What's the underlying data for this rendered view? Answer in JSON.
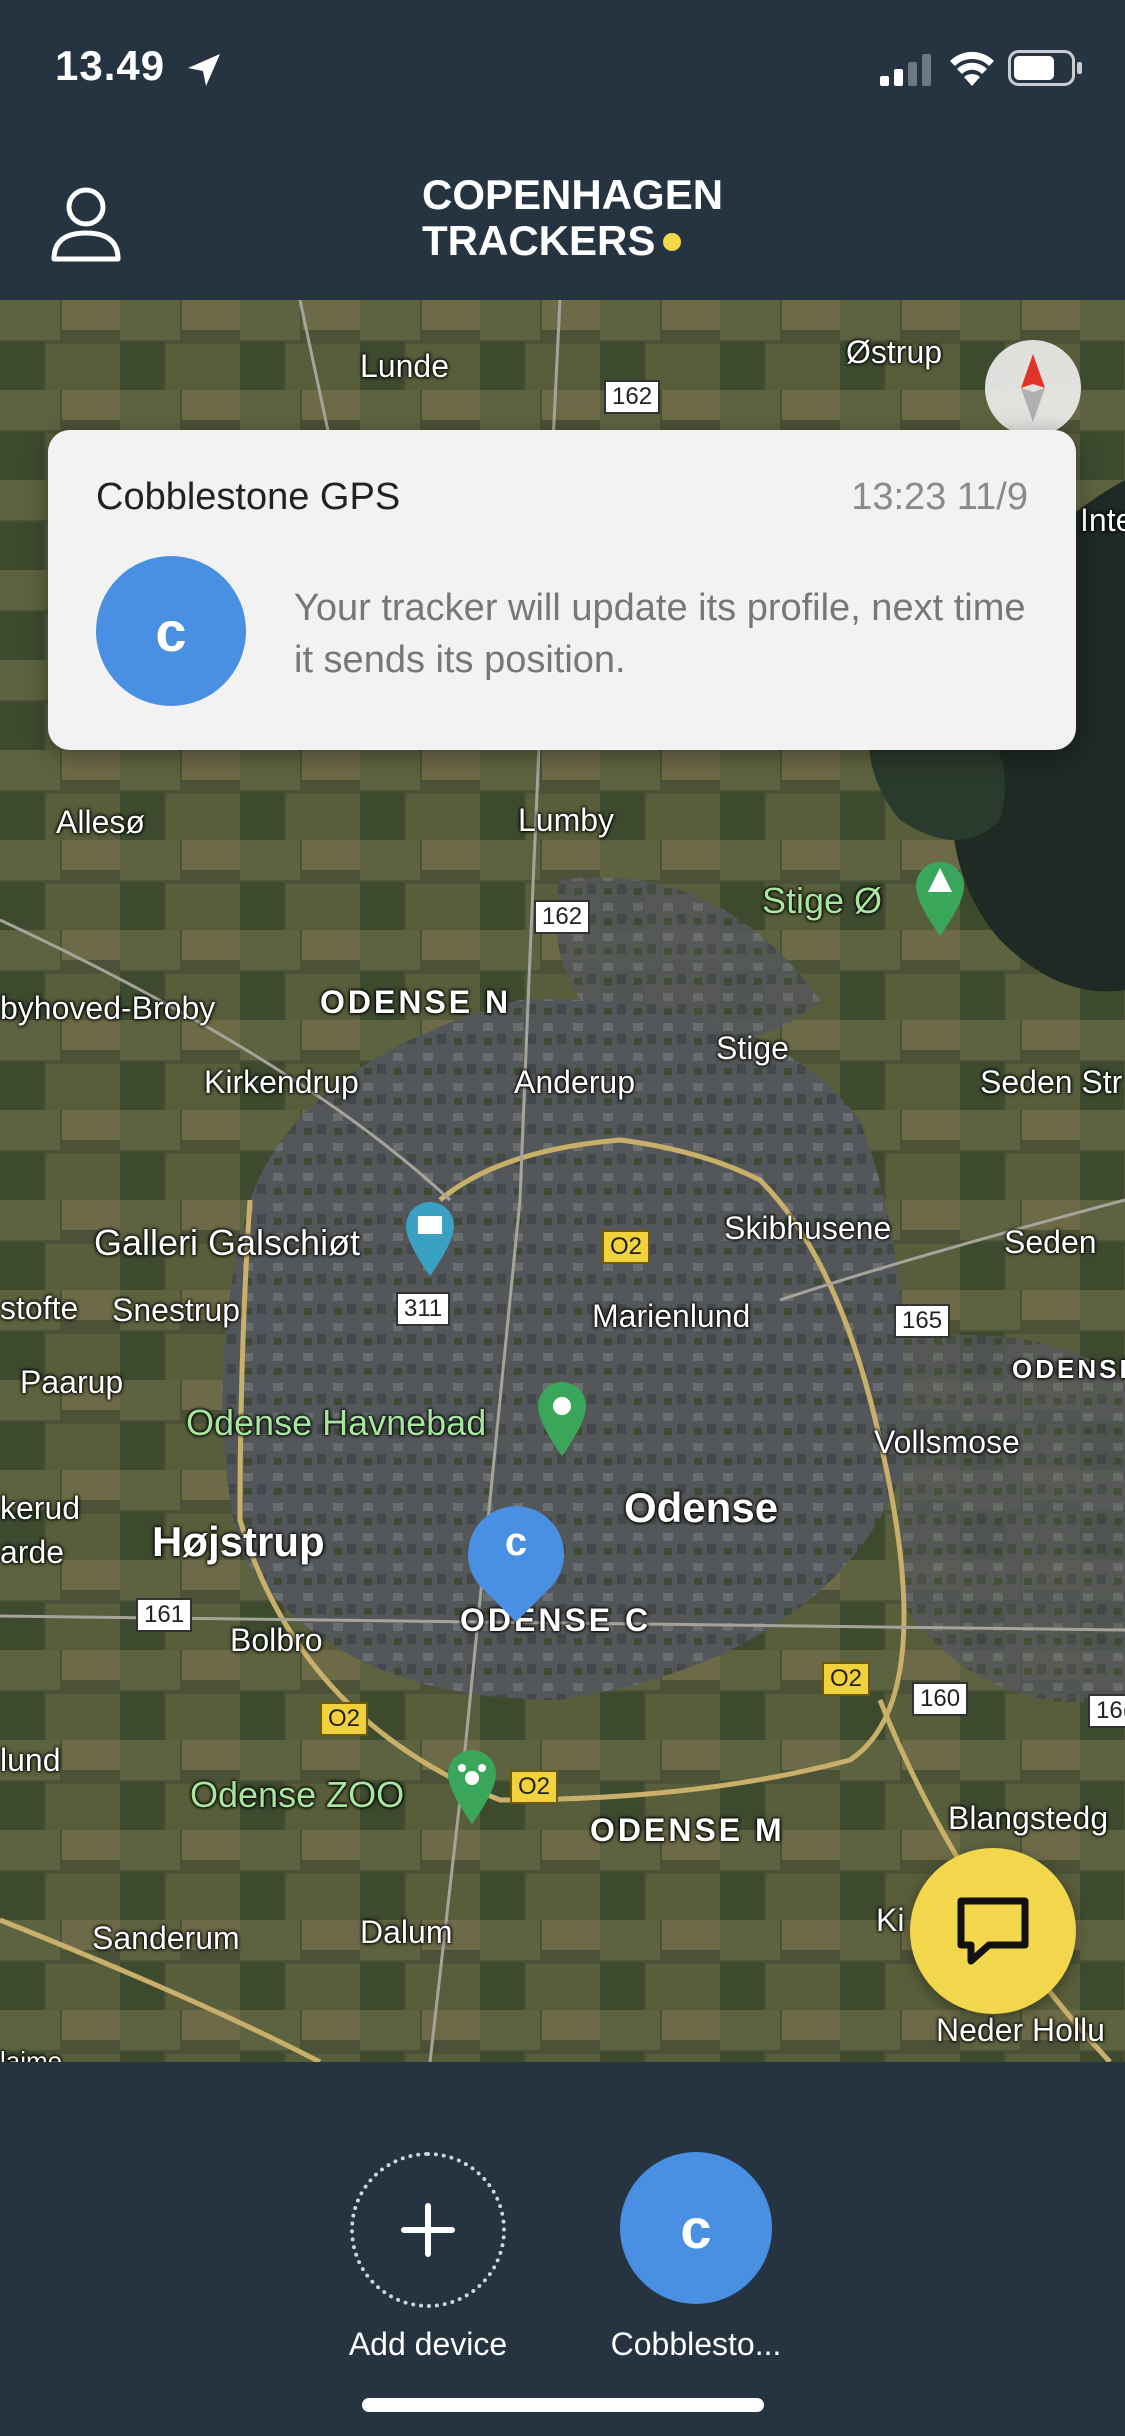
{
  "status_bar": {
    "time": "13.49",
    "icons": [
      "location-arrow-icon",
      "cellular-signal-icon",
      "wifi-icon",
      "battery-icon"
    ]
  },
  "header": {
    "brand_line1": "COPENHAGEN",
    "brand_line2": "TRACKERS",
    "brand_dot_color": "#f2d64b",
    "profile_icon": "user-icon"
  },
  "notification": {
    "title": "Cobblestone GPS",
    "time": "13:23 11/9",
    "avatar_letter": "c",
    "message": "Your tracker will update its profile, next time it sends its position."
  },
  "map": {
    "places": [
      {
        "id": "lunde",
        "text": "Lunde"
      },
      {
        "id": "ostrup",
        "text": "Østrup"
      },
      {
        "id": "inte",
        "text": "Inte"
      },
      {
        "id": "alleso",
        "text": "Allesø"
      },
      {
        "id": "lumby",
        "text": "Lumby"
      },
      {
        "id": "stige-o",
        "text": "Stige Ø"
      },
      {
        "id": "broby",
        "text": "byhoved-Broby"
      },
      {
        "id": "odense-n",
        "text": "ODENSE N"
      },
      {
        "id": "stige",
        "text": "Stige"
      },
      {
        "id": "kirkendrup",
        "text": "Kirkendrup"
      },
      {
        "id": "anderup",
        "text": "Anderup"
      },
      {
        "id": "seden-str",
        "text": "Seden Str"
      },
      {
        "id": "galleri",
        "text": "Galleri Galschiøt"
      },
      {
        "id": "skibhusene",
        "text": "Skibhusene"
      },
      {
        "id": "seden",
        "text": "Seden"
      },
      {
        "id": "stofte",
        "text": "stofte"
      },
      {
        "id": "snestrup",
        "text": "Snestrup"
      },
      {
        "id": "marienlund",
        "text": "Marienlund"
      },
      {
        "id": "odense-e",
        "text": "ODENSE"
      },
      {
        "id": "paarup",
        "text": "Paarup"
      },
      {
        "id": "havnebad",
        "text": "Odense Havnebad"
      },
      {
        "id": "vollsmose",
        "text": "Vollsmose"
      },
      {
        "id": "kerud",
        "text": "kerud"
      },
      {
        "id": "arde",
        "text": "arde"
      },
      {
        "id": "hojstrup",
        "text": "Højstrup"
      },
      {
        "id": "odense",
        "text": "Odense"
      },
      {
        "id": "odense-c",
        "text": "ODENSE C"
      },
      {
        "id": "bolbro",
        "text": "Bolbro"
      },
      {
        "id": "lund",
        "text": "lund"
      },
      {
        "id": "zoo",
        "text": "Odense ZOO"
      },
      {
        "id": "odense-m",
        "text": "ODENSE M"
      },
      {
        "id": "blangstedg",
        "text": "Blangstedg"
      },
      {
        "id": "sanderum",
        "text": "Sanderum"
      },
      {
        "id": "dalum",
        "text": "Dalum"
      },
      {
        "id": "ki",
        "text": "Ki"
      },
      {
        "id": "neder",
        "text": "Neder Hollu"
      },
      {
        "id": "laime",
        "text": "laime"
      }
    ],
    "road_shields": [
      {
        "id": "r162a",
        "text": "162"
      },
      {
        "id": "r162b",
        "text": "162"
      },
      {
        "id": "r311",
        "text": "311"
      },
      {
        "id": "r02a",
        "text": "O2"
      },
      {
        "id": "r165",
        "text": "165"
      },
      {
        "id": "r161",
        "text": "161"
      },
      {
        "id": "r02b",
        "text": "O2"
      },
      {
        "id": "r160",
        "text": "160"
      },
      {
        "id": "r16x",
        "text": "16("
      },
      {
        "id": "r02c",
        "text": "O2"
      },
      {
        "id": "r02d",
        "text": "O2"
      }
    ],
    "tracker_pin_letter": "c",
    "accent": "#4a90e2"
  },
  "bottom_bar": {
    "add_label": "Add device",
    "device_letter": "c",
    "device_label": "Cobblesto..."
  },
  "fab": {
    "icon": "chat-bubble-icon",
    "color": "#f2d64b"
  }
}
